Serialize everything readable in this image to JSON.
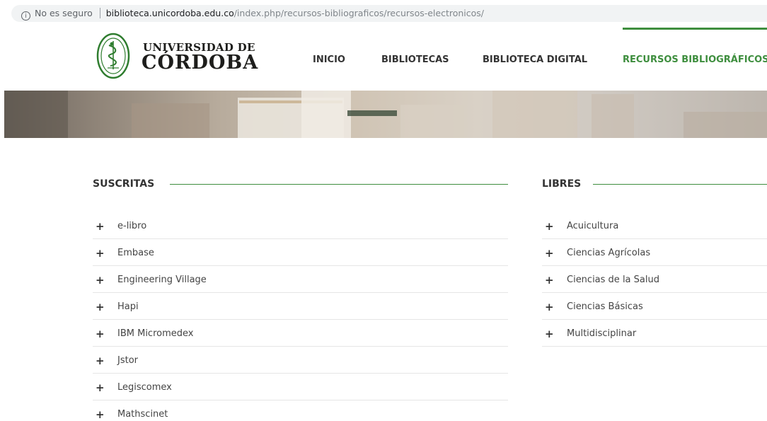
{
  "browser": {
    "security_label": "No es seguro",
    "url_host": "biblioteca.unicordoba.edu.co",
    "url_path": "/index.php/recursos-bibliograficos/recursos-electronicos/"
  },
  "logo": {
    "line1": "UNIVERSIDAD DE",
    "line2": "CÓRDOBA"
  },
  "nav": {
    "items": [
      {
        "label": "INICIO"
      },
      {
        "label": "BIBLIOTECAS"
      },
      {
        "label": "BIBLIOTECA DIGITAL"
      },
      {
        "label": "RECURSOS BIBLIOGRÁFICOS"
      }
    ],
    "active_index": 3
  },
  "colors": {
    "accent": "#3e8e3e"
  },
  "sections": {
    "subscribed": {
      "title": "SUSCRITAS",
      "items": [
        "e-libro",
        "Embase",
        "Engineering Village",
        "Hapi",
        "IBM Micromedex",
        "Jstor",
        "Legiscomex",
        "Mathscinet"
      ]
    },
    "free": {
      "title": "LIBRES",
      "items": [
        "Acuicultura",
        "Ciencias Agrícolas",
        "Ciencias de la Salud",
        "Ciencias Básicas",
        "Multidisciplinar"
      ]
    }
  },
  "icons": {
    "expand": "+"
  }
}
